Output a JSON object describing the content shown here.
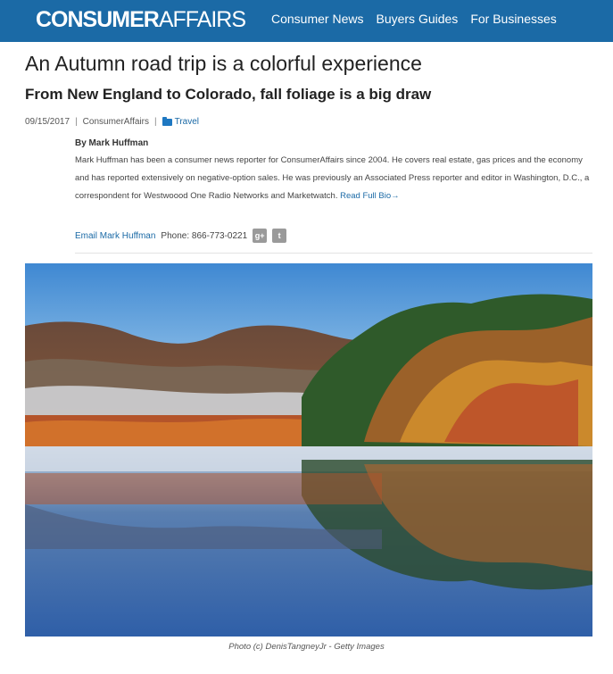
{
  "header": {
    "logo_bold": "CONSUMER",
    "logo_normal": "AFFAIRS",
    "nav": [
      "Consumer News",
      "Buyers Guides",
      "For Businesses"
    ]
  },
  "article": {
    "title": "An Autumn road trip is a colorful experience",
    "subtitle": "From New England to Colorado, fall foliage is a big draw",
    "date": "09/15/2017",
    "source": "ConsumerAffairs",
    "category": "Travel"
  },
  "author": {
    "byline": "By Mark Huffman",
    "bio": "Mark Huffman has been a consumer news reporter for ConsumerAffairs since 2004. He covers real estate, gas prices and the economy and has reported extensively on negative-option sales. He was previously an Associated Press reporter and editor in Washington, D.C., a correspondent for Westwoood One Radio Networks and Marketwatch.",
    "read_bio": "Read Full Bio→",
    "email_label": "Email Mark Huffman",
    "phone": "Phone: 866-773-0221",
    "gplus": "g+",
    "twitter": "t"
  },
  "photo": {
    "caption": "Photo (c) DenisTangneyJr - Getty Images"
  },
  "colors": {
    "brand": "#1b6aa6"
  },
  "icons": [
    "folder-icon",
    "google-plus-icon",
    "twitter-icon"
  ]
}
